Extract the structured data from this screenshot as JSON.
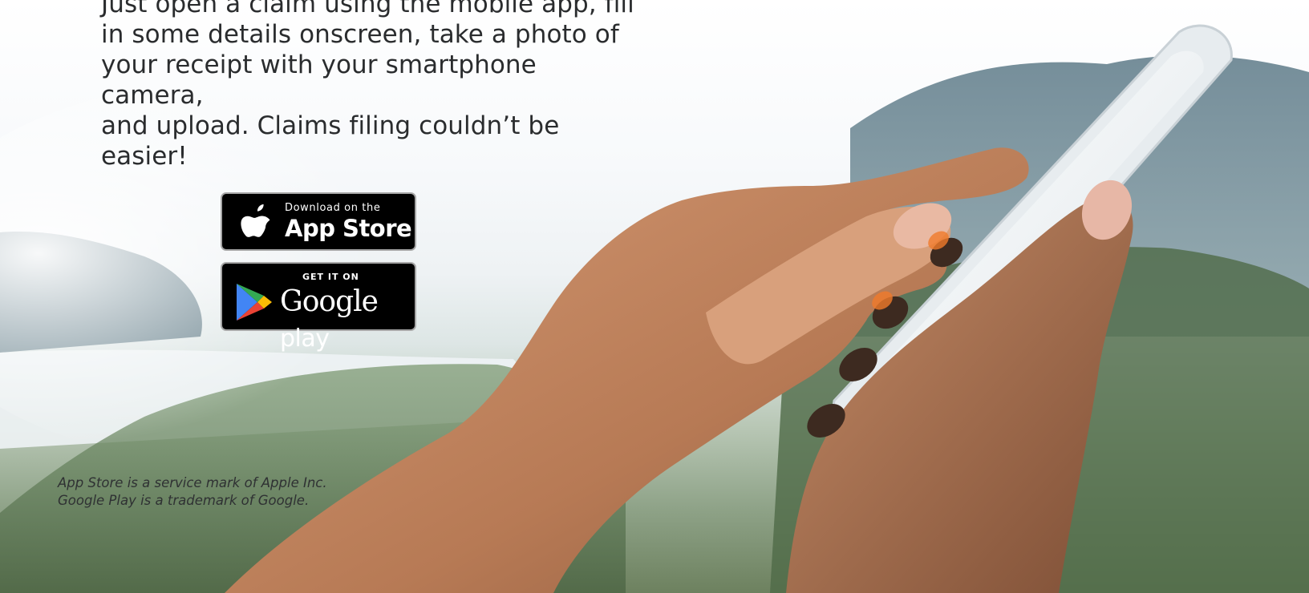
{
  "intro": {
    "lines": [
      "Just open a claim using the mobile app, fill",
      "in some details onscreen, take a photo of",
      "your receipt with your smartphone camera,",
      "and upload. Claims filing couldn’t be easier!"
    ]
  },
  "badges": {
    "app_store": {
      "small_text": "Download on the",
      "big_text": "App Store",
      "icon": "apple-icon"
    },
    "google_play": {
      "small_text": "GET IT ON",
      "big_text_brand": "Google",
      "big_text_word": "play",
      "icon": "google-play-icon"
    }
  },
  "legal": {
    "line1": "App Store is a service mark of Apple Inc.",
    "line2": "Google Play is a trademark of Google."
  },
  "colors": {
    "text": "#2a2c2e",
    "badge_bg": "#000000",
    "badge_border": "#a6a6a6",
    "play_green": "#34a853",
    "play_blue": "#4285f4",
    "play_yellow": "#fbbc05",
    "play_red": "#ea4335",
    "skin": "#c98a63",
    "phone": "#f2f4f6"
  }
}
